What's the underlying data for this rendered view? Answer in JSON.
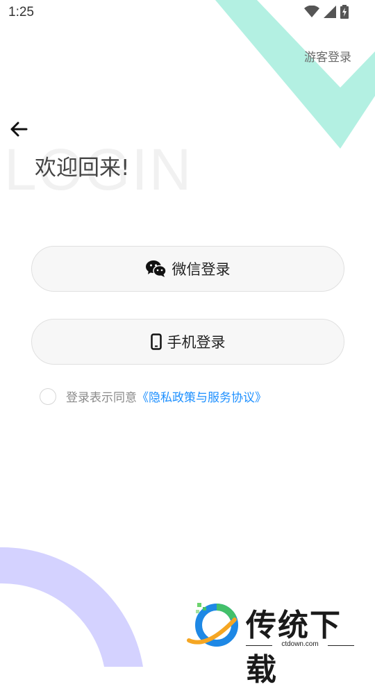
{
  "status_bar": {
    "time": "1:25"
  },
  "header": {
    "guest_login": "游客登录"
  },
  "welcome": {
    "watermark": "LOGIN",
    "title": "欢迎回来!"
  },
  "buttons": {
    "wechat_login": "微信登录",
    "phone_login": "手机登录"
  },
  "agreement": {
    "prefix": "登录表示同意",
    "link": "《隐私政策与服务协议》"
  },
  "brand": {
    "name": "传统下载",
    "domain": "ctdown.com"
  },
  "colors": {
    "accent_link": "#1e90ff",
    "deco_green": "#b3f0e2",
    "deco_purple": "#d4d2ff"
  }
}
